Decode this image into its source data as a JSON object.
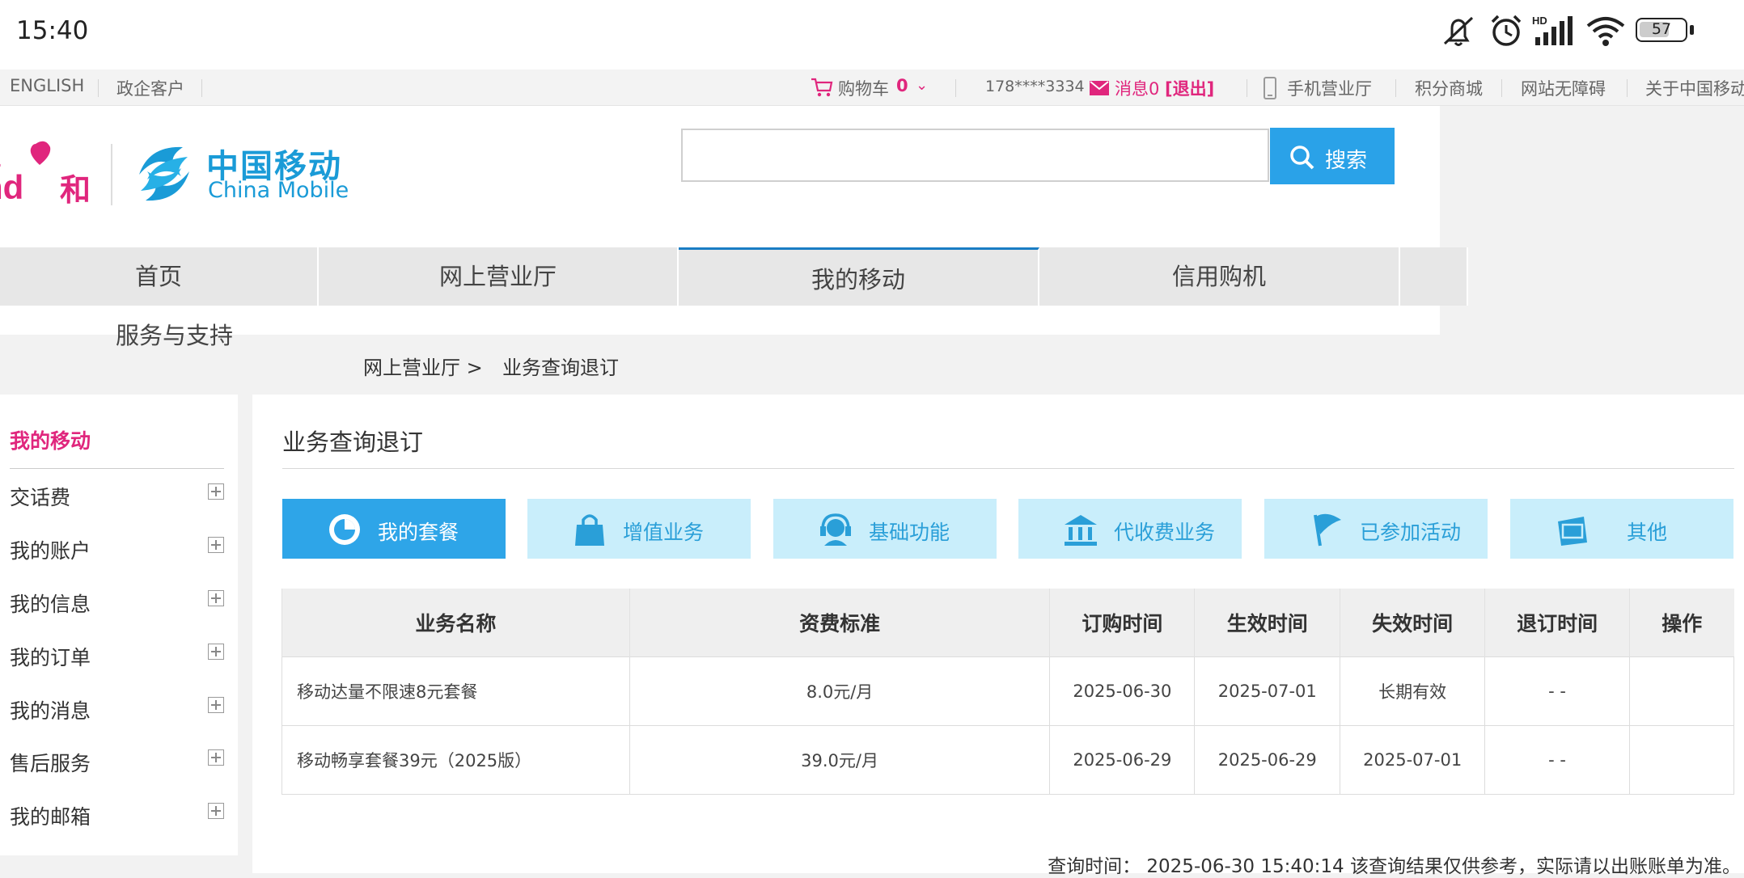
{
  "status_bar": {
    "time": "15:40",
    "battery": "57"
  },
  "top_links": {
    "english": "ENGLISH",
    "gov": "政企客户",
    "cart_label": "购物车",
    "cart_count": "0",
    "phone": "178****3334",
    "messages": "消息0",
    "logout": "[退出]",
    "mobile_hall": "手机营业厅",
    "points_mall": "积分商城",
    "accessibility": "网站无障碍",
    "about": "关于中国移动"
  },
  "logo": {
    "he_text": "和",
    "cn_name": "中国移动",
    "en_name": "China Mobile"
  },
  "search": {
    "placeholder": "",
    "button": "搜索"
  },
  "nav": {
    "items": [
      "首页",
      "网上营业厅",
      "我的移动",
      "信用购机"
    ],
    "sub": "服务与支持"
  },
  "breadcrumb": {
    "parent": "网上营业厅 >",
    "current": "业务查询退订"
  },
  "sidebar": {
    "title": "我的移动",
    "items": [
      "交话费",
      "我的账户",
      "我的信息",
      "我的订单",
      "我的消息",
      "售后服务",
      "我的邮箱"
    ]
  },
  "main": {
    "title": "业务查询退订",
    "tabs": [
      {
        "label": "我的套餐",
        "icon": "clock-icon",
        "active": true
      },
      {
        "label": "增值业务",
        "icon": "bag-icon",
        "active": false
      },
      {
        "label": "基础功能",
        "icon": "headset-icon",
        "active": false
      },
      {
        "label": "代收费业务",
        "icon": "bank-icon",
        "active": false
      },
      {
        "label": "已参加活动",
        "icon": "flag-icon",
        "active": false
      },
      {
        "label": "其他",
        "icon": "box-icon",
        "active": false
      }
    ],
    "table": {
      "headers": [
        "业务名称",
        "资费标准",
        "订购时间",
        "生效时间",
        "失效时间",
        "退订时间",
        "操作"
      ],
      "rows": [
        [
          "移动达量不限速8元套餐",
          "8.0元/月",
          "2025-06-30",
          "2025-07-01",
          "长期有效",
          "- -",
          ""
        ],
        [
          "移动畅享套餐39元（2025版）",
          "39.0元/月",
          "2025-06-29",
          "2025-06-29",
          "2025-07-01",
          "- -",
          ""
        ]
      ]
    },
    "footer_note": "查询时间： 2025-06-30 15:40:14 该查询结果仅供参考，实际请以出账账单为准。"
  },
  "colors": {
    "brand_pink": "#e0267d",
    "brand_blue": "#2aa2e8",
    "tab_light": "#c9eefb"
  }
}
